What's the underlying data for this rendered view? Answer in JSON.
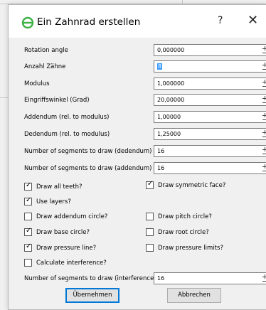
{
  "window": {
    "title": "Ein Zahnrad erstellen",
    "help_label": "?",
    "close_label": "✕"
  },
  "fields": [
    {
      "label": "Rotation angle",
      "value": "0,000000"
    },
    {
      "label": "Anzahl Zähne",
      "value": "8"
    },
    {
      "label": "Modulus",
      "value": "1,000000"
    },
    {
      "label": "Eingriffswinkel (Grad)",
      "value": "20,00000"
    },
    {
      "label": "Addendum (rel. to modulus)",
      "value": "1,00000"
    },
    {
      "label": "Dedendum (rel. to modulus)",
      "value": "1,25000"
    },
    {
      "label": "Number of segments to draw (dedendum)",
      "value": "16"
    },
    {
      "label": "Number of segments to draw (addendum)",
      "value": "16"
    }
  ],
  "checkboxes": [
    {
      "label": "Draw all teeth?",
      "checked": true
    },
    {
      "label": "Draw symmetric face?",
      "checked": true
    },
    {
      "label": "Use layers?",
      "checked": true
    },
    {
      "label": "Draw addendum circle?",
      "checked": false
    },
    {
      "label": "Draw pitch circle?",
      "checked": false
    },
    {
      "label": "Draw base circle?",
      "checked": true
    },
    {
      "label": "Draw root circle?",
      "checked": false
    },
    {
      "label": "Draw pressure line?",
      "checked": true
    },
    {
      "label": "Draw pressure limits?",
      "checked": false
    },
    {
      "label": "Calculate interference?",
      "checked": false
    }
  ],
  "interference_field": {
    "label": "Number of segments to draw (interference)",
    "value": "16"
  },
  "buttons": {
    "ok": "Übernehmen",
    "cancel": "Abbrechen"
  },
  "colors": {
    "gear_icon": "#3cb043",
    "selection": "#3399ff"
  }
}
